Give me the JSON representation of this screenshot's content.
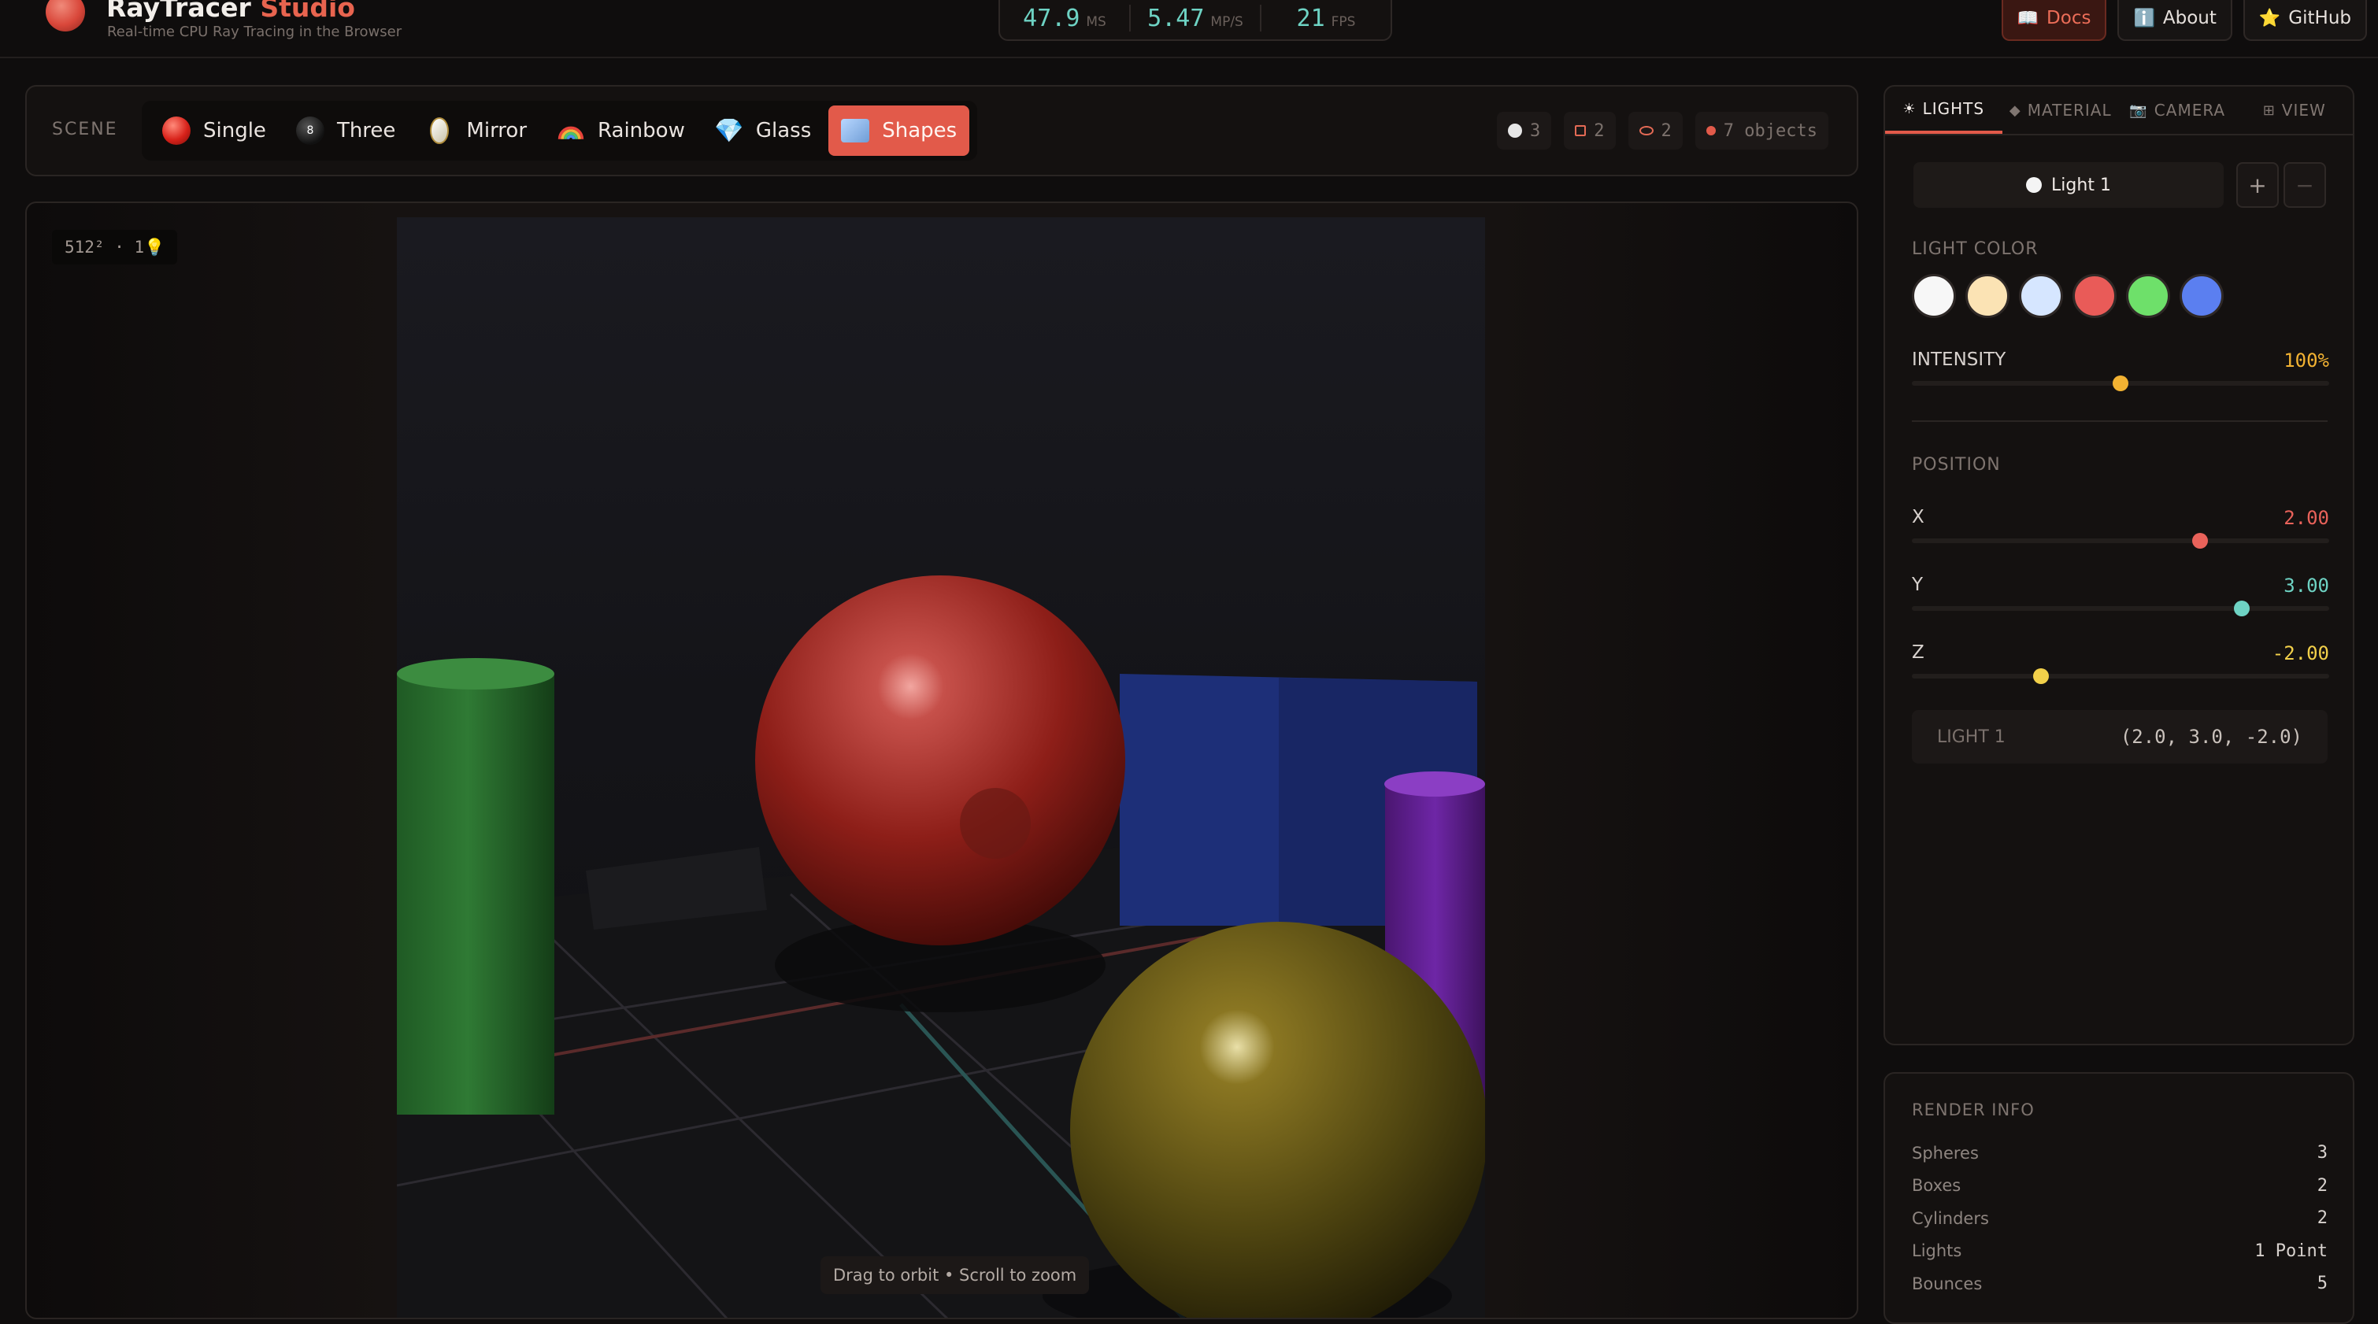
{
  "header": {
    "title_main": "RayTracer",
    "title_accent": "Studio",
    "subtitle": "Real-time CPU Ray Tracing in the Browser",
    "stats": [
      {
        "value": "47.9",
        "unit": "MS"
      },
      {
        "value": "5.47",
        "unit": "MP/S"
      },
      {
        "value": "21",
        "unit": "FPS"
      }
    ],
    "links": [
      {
        "label": "Docs",
        "icon": "book-icon",
        "glyph": "📖",
        "active": true
      },
      {
        "label": "About",
        "icon": "info-icon",
        "glyph": "ℹ️",
        "active": false
      },
      {
        "label": "GitHub",
        "icon": "star-icon",
        "glyph": "⭐",
        "active": false
      }
    ]
  },
  "scene": {
    "label": "SCENE",
    "tabs": [
      {
        "label": "Single",
        "icon": "red-sphere-icon"
      },
      {
        "label": "Three",
        "icon": "eight-ball-icon"
      },
      {
        "label": "Mirror",
        "icon": "mirror-icon"
      },
      {
        "label": "Rainbow",
        "icon": "rainbow-icon"
      },
      {
        "label": "Glass",
        "icon": "gem-icon"
      },
      {
        "label": "Shapes",
        "icon": "shapes-icon",
        "active": true
      }
    ],
    "counts": {
      "spheres": "3",
      "boxes": "2",
      "cylinders": "2",
      "objects": "7 objects"
    }
  },
  "viewport": {
    "resolution_badge": "512² · 1💡",
    "hint": "Drag to orbit • Scroll to zoom"
  },
  "panel": {
    "tabs": [
      {
        "label": "LIGHTS",
        "icon": "sun-icon",
        "glyph": "☀",
        "active": true
      },
      {
        "label": "MATERIAL",
        "icon": "diamond-icon",
        "glyph": "◆",
        "active": false
      },
      {
        "label": "CAMERA",
        "icon": "camera-icon",
        "glyph": "📷",
        "active": false
      },
      {
        "label": "VIEW",
        "icon": "grid-icon",
        "glyph": "⊞",
        "active": false
      }
    ],
    "light_select": "Light 1",
    "add_label": "+",
    "remove_label": "−",
    "light_color_label": "LIGHT COLOR",
    "swatches": [
      "#f7f7f7",
      "#fbe3b4",
      "#d6e6ff",
      "#e95b58",
      "#6ee06a",
      "#5b7ff0"
    ],
    "intensity": {
      "label": "INTENSITY",
      "value": "100%",
      "fraction": 0.5,
      "color": "#f2b232"
    },
    "position_label": "POSITION",
    "x": {
      "label": "X",
      "value": "2.00",
      "fraction": 0.69,
      "color": "#e9625a"
    },
    "y": {
      "label": "Y",
      "value": "3.00",
      "fraction": 0.79,
      "color": "#6ed3c4"
    },
    "z": {
      "label": "Z",
      "value": "-2.00",
      "fraction": 0.31,
      "color": "#f2d04a"
    },
    "summary_label": "LIGHT 1",
    "summary_value": "(2.0, 3.0, -2.0)"
  },
  "render_info": {
    "title": "RENDER INFO",
    "rows": [
      {
        "label": "Spheres",
        "value": "3"
      },
      {
        "label": "Boxes",
        "value": "2"
      },
      {
        "label": "Cylinders",
        "value": "2"
      },
      {
        "label": "Lights",
        "value": "1 Point"
      },
      {
        "label": "Bounces",
        "value": "5"
      }
    ]
  }
}
